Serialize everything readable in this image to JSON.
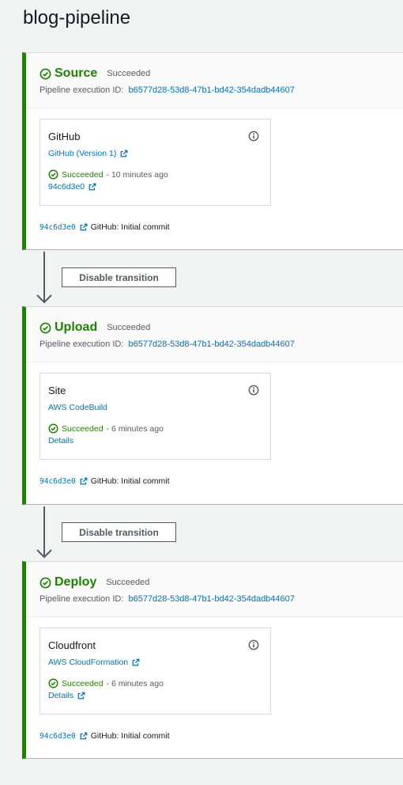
{
  "page": {
    "title": "blog-pipeline"
  },
  "stages": [
    {
      "name": "Source",
      "status": "Succeeded",
      "exec_label": "Pipeline execution ID:",
      "exec_id": "b6577d28-53d8-47b1-bd42-354dadb44607",
      "action": {
        "name": "GitHub",
        "provider": "GitHub (Version 1)",
        "status": "Succeeded",
        "time": "- 10 minutes ago",
        "detail": "94c6d3e0"
      },
      "commit_id": "94c6d3e0",
      "commit_msg": "GitHub: Initial commit"
    },
    {
      "name": "Upload",
      "status": "Succeeded",
      "exec_label": "Pipeline execution ID:",
      "exec_id": "b6577d28-53d8-47b1-bd42-354dadb44607",
      "action": {
        "name": "Site",
        "provider": "AWS CodeBuild",
        "status": "Succeeded",
        "time": "- 6 minutes ago",
        "detail": "Details"
      },
      "commit_id": "94c6d3e0",
      "commit_msg": "GitHub: Initial commit"
    },
    {
      "name": "Deploy",
      "status": "Succeeded",
      "exec_label": "Pipeline execution ID:",
      "exec_id": "b6577d28-53d8-47b1-bd42-354dadb44607",
      "action": {
        "name": "Cloudfront",
        "provider": "AWS CloudFormation",
        "status": "Succeeded",
        "time": "- 6 minutes ago",
        "detail": "Details"
      },
      "commit_id": "94c6d3e0",
      "commit_msg": "GitHub: Initial commit"
    }
  ],
  "transitions": [
    {
      "button_label": "Disable transition"
    },
    {
      "button_label": "Disable transition"
    }
  ],
  "colors": {
    "success": "#1d8102",
    "link": "#0073bb",
    "text": "#16191f",
    "muted": "#545b64",
    "background": "#f2f3f3"
  },
  "icons": {
    "status": "check-circle-icon",
    "info": "info-icon",
    "external": "external-link-icon",
    "arrow": "arrow-down-icon"
  }
}
